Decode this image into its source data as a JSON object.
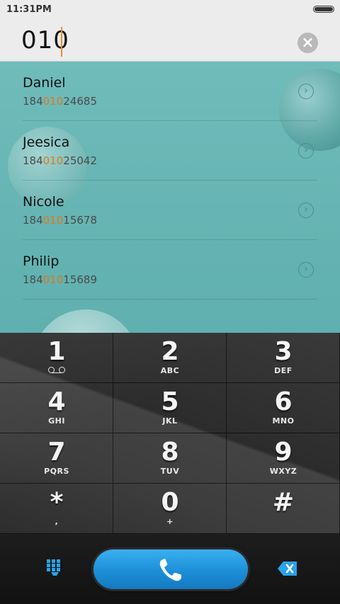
{
  "status_bar": {
    "time": "11:31PM"
  },
  "dialer": {
    "input": "010"
  },
  "contacts": [
    {
      "name": "Daniel",
      "number_pre": "184",
      "number_match": "010",
      "number_post": "24685"
    },
    {
      "name": "Jeesica",
      "number_pre": "184",
      "number_match": "010",
      "number_post": "25042"
    },
    {
      "name": "Nicole",
      "number_pre": "184",
      "number_match": "010",
      "number_post": "15678"
    },
    {
      "name": "Philip",
      "number_pre": "184",
      "number_match": "010",
      "number_post": "15689"
    }
  ],
  "keypad": [
    {
      "digit": "1",
      "letters": ""
    },
    {
      "digit": "2",
      "letters": "ABC"
    },
    {
      "digit": "3",
      "letters": "DEF"
    },
    {
      "digit": "4",
      "letters": "GHI"
    },
    {
      "digit": "5",
      "letters": "JKL"
    },
    {
      "digit": "6",
      "letters": "MNO"
    },
    {
      "digit": "7",
      "letters": "PQRS"
    },
    {
      "digit": "8",
      "letters": "TUV"
    },
    {
      "digit": "9",
      "letters": "WXYZ"
    },
    {
      "digit": "*",
      "letters": ","
    },
    {
      "digit": "0",
      "letters": "+"
    },
    {
      "digit": "#",
      "letters": ""
    }
  ],
  "icons": {
    "clear": "close-icon",
    "contact_detail": "chevron-right-icon",
    "voicemail": "voicemail-icon",
    "dialpad": "dialpad-grid-icon",
    "call": "phone-icon",
    "backspace": "backspace-icon"
  },
  "colors": {
    "match_highlight": "#e2761c",
    "cursor": "#f28b2c",
    "call_button": "#1c8fd8",
    "accent": "#2aa2e8",
    "results_background": "#67b5b4"
  }
}
